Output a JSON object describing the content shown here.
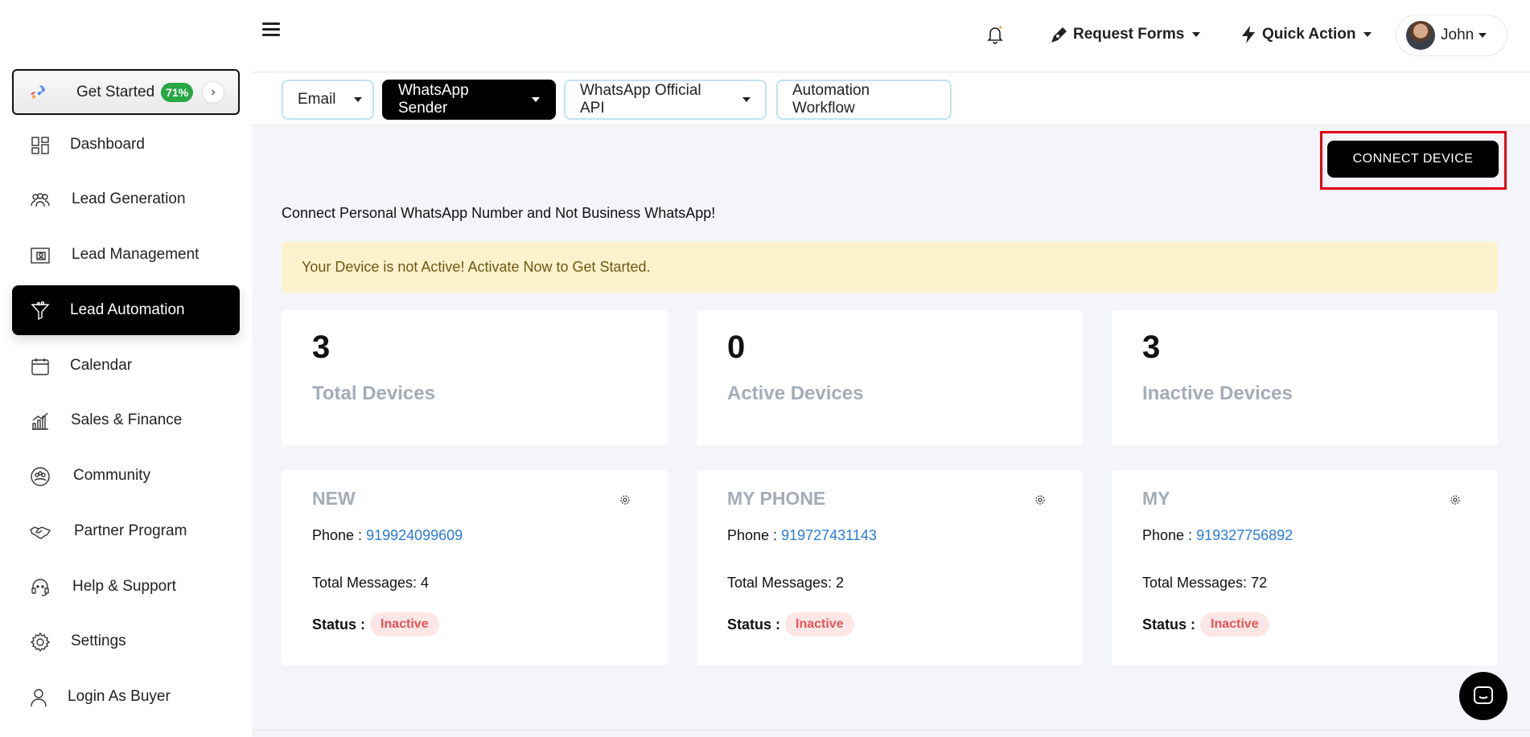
{
  "sidebar": {
    "get_started": {
      "label": "Get Started",
      "progress": "71%"
    },
    "items": [
      {
        "label": "Dashboard",
        "icon": "dashboard-icon"
      },
      {
        "label": "Lead Generation",
        "icon": "users-group-icon"
      },
      {
        "label": "Lead Management",
        "icon": "contact-card-icon"
      },
      {
        "label": "Lead Automation",
        "icon": "funnel-icon",
        "active": true
      },
      {
        "label": "Calendar",
        "icon": "calendar-icon"
      },
      {
        "label": "Sales & Finance",
        "icon": "bar-chart-icon"
      },
      {
        "label": "Community",
        "icon": "community-icon"
      },
      {
        "label": "Partner Program",
        "icon": "handshake-icon"
      },
      {
        "label": "Help & Support",
        "icon": "headset-icon"
      },
      {
        "label": "Settings",
        "icon": "gear-icon"
      },
      {
        "label": "Login As Buyer",
        "icon": "user-icon"
      }
    ]
  },
  "topbar": {
    "request_forms": "Request Forms",
    "quick_action": "Quick Action",
    "user_name": "John"
  },
  "tabs": [
    {
      "label": "Email",
      "dropdown": true
    },
    {
      "label": "WhatsApp Sender",
      "dropdown": true,
      "active": true
    },
    {
      "label": "WhatsApp Official API",
      "dropdown": true
    },
    {
      "label": "Automation Workflow",
      "dropdown": false
    }
  ],
  "main": {
    "connect_button": "CONNECT DEVICE",
    "notice": "Connect Personal WhatsApp Number and Not Business WhatsApp!",
    "alert": "Your Device is not Active! Activate Now to Get Started.",
    "stats": [
      {
        "value": "3",
        "label": "Total Devices"
      },
      {
        "value": "0",
        "label": "Active Devices"
      },
      {
        "value": "3",
        "label": "Inactive Devices"
      }
    ],
    "devices": [
      {
        "name": "NEW",
        "phone_label": "Phone : ",
        "phone": "919924099609",
        "messages": "Total Messages: 4",
        "status_label": "Status :",
        "status": "Inactive"
      },
      {
        "name": "MY PHONE",
        "phone_label": "Phone : ",
        "phone": "919727431143",
        "messages": "Total Messages: 2",
        "status_label": "Status :",
        "status": "Inactive"
      },
      {
        "name": "MY",
        "phone_label": "Phone : ",
        "phone": "919327756892",
        "messages": "Total Messages: 72",
        "status_label": "Status :",
        "status": "Inactive"
      }
    ]
  },
  "colors": {
    "accent": "#000000",
    "progress_badge": "#28a745",
    "alert_bg": "#fdf2cd",
    "link": "#2b7bd6",
    "inactive_badge_bg": "#fde6e6",
    "inactive_badge_text": "#e25656",
    "highlight": "#e3000f"
  }
}
